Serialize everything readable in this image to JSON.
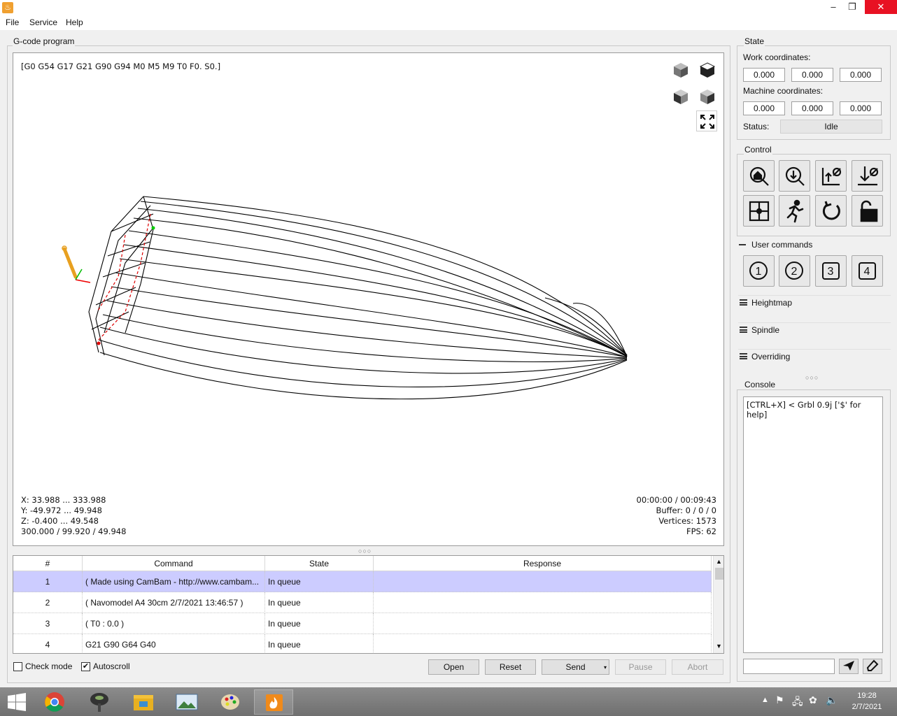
{
  "menu": [
    "File",
    "Service",
    "Help"
  ],
  "gcode_group_title": "G-code program",
  "viewer": {
    "parser_state": "[G0 G54 G17 G21 G90 G94 M0 M5 M9 T0 F0. S0.]",
    "range_x": "X: 33.988 ... 333.988",
    "range_y": "Y: -49.972 ... 49.948",
    "range_z": "Z: -0.400 ... 49.548",
    "size": "300.000 / 99.920 / 49.948",
    "time": "00:00:00 / 00:09:43",
    "buffer": "Buffer: 0 / 0 / 0",
    "vertices": "Vertices: 1573",
    "fps": "FPS: 62"
  },
  "table": {
    "headers": [
      "#",
      "Command",
      "State",
      "Response"
    ],
    "rows": [
      {
        "num": "1",
        "command": "( Made using CamBam - http://www.cambam...",
        "state": "In queue",
        "response": ""
      },
      {
        "num": "2",
        "command": "( Navomodel A4 30cm 2/7/2021 13:46:57 )",
        "state": "In queue",
        "response": ""
      },
      {
        "num": "3",
        "command": "( T0 : 0.0 )",
        "state": "In queue",
        "response": ""
      },
      {
        "num": "4",
        "command": "G21 G90 G64 G40",
        "state": "In queue",
        "response": ""
      }
    ]
  },
  "bottom": {
    "check_mode": "Check mode",
    "autoscroll": "Autoscroll",
    "open": "Open",
    "reset": "Reset",
    "send": "Send",
    "pause": "Pause",
    "abort": "Abort"
  },
  "state": {
    "title": "State",
    "work_label": "Work coordinates:",
    "work": [
      "0.000",
      "0.000",
      "0.000"
    ],
    "machine_label": "Machine coordinates:",
    "machine": [
      "0.000",
      "0.000",
      "0.000"
    ],
    "status_label": "Status:",
    "status": "Idle"
  },
  "control_title": "Control",
  "user_commands": {
    "title": "User commands",
    "buttons": [
      "1",
      "2",
      "3",
      "4"
    ]
  },
  "heightmap": "Heightmap",
  "spindle": "Spindle",
  "overriding": "Overriding",
  "console": {
    "title": "Console",
    "text": "[CTRL+X] < Grbl 0.9j ['$' for help]"
  },
  "taskbar": {
    "time": "19:28",
    "date": "2/7/2021"
  },
  "colors": {
    "selected_row": "#ccccff",
    "close_button": "#e81123",
    "taskbar": "#7a7a7a"
  }
}
